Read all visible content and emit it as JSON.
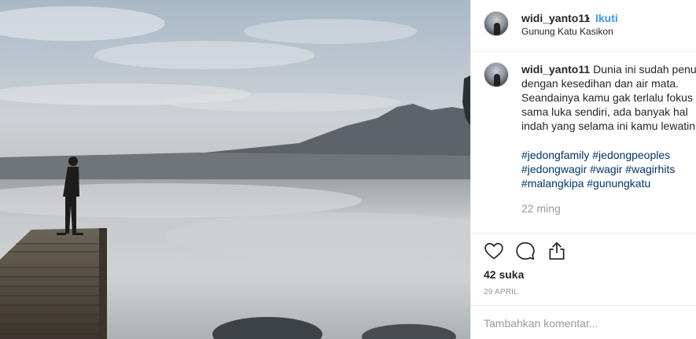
{
  "post": {
    "author": "widi_yanto11",
    "separator": "•",
    "follow_label": "Ikuti",
    "location": "Gunung Katu Kasikon"
  },
  "caption": {
    "author": "widi_yanto11",
    "lines": [
      "Dunia ini sudah penuh",
      "dengan kesedihan dan air mata.",
      "Seandainya kamu gak terlalu fokus",
      "sama luka sendiri, ada banyak hal",
      "indah yang selama ini kamu lewatin."
    ],
    "hashtag_lines": [
      "#jedongfamily #jedongpeoples",
      "#jedongwagir #wagir #wagirhits",
      "#malangkipa #gunungkatu"
    ],
    "time_ago": "22 ming"
  },
  "actions": {
    "like_icon": "heart-icon",
    "comment_icon": "comment-icon",
    "share_icon": "share-icon",
    "likes_text": "42 suka",
    "date_text": "29 APRIL"
  },
  "comment": {
    "placeholder": "Tambahkan komentar..."
  },
  "colors": {
    "link_blue": "#3897f0",
    "hashtag": "#003569",
    "muted": "#999999",
    "text": "#262626",
    "divider": "#efefef"
  }
}
